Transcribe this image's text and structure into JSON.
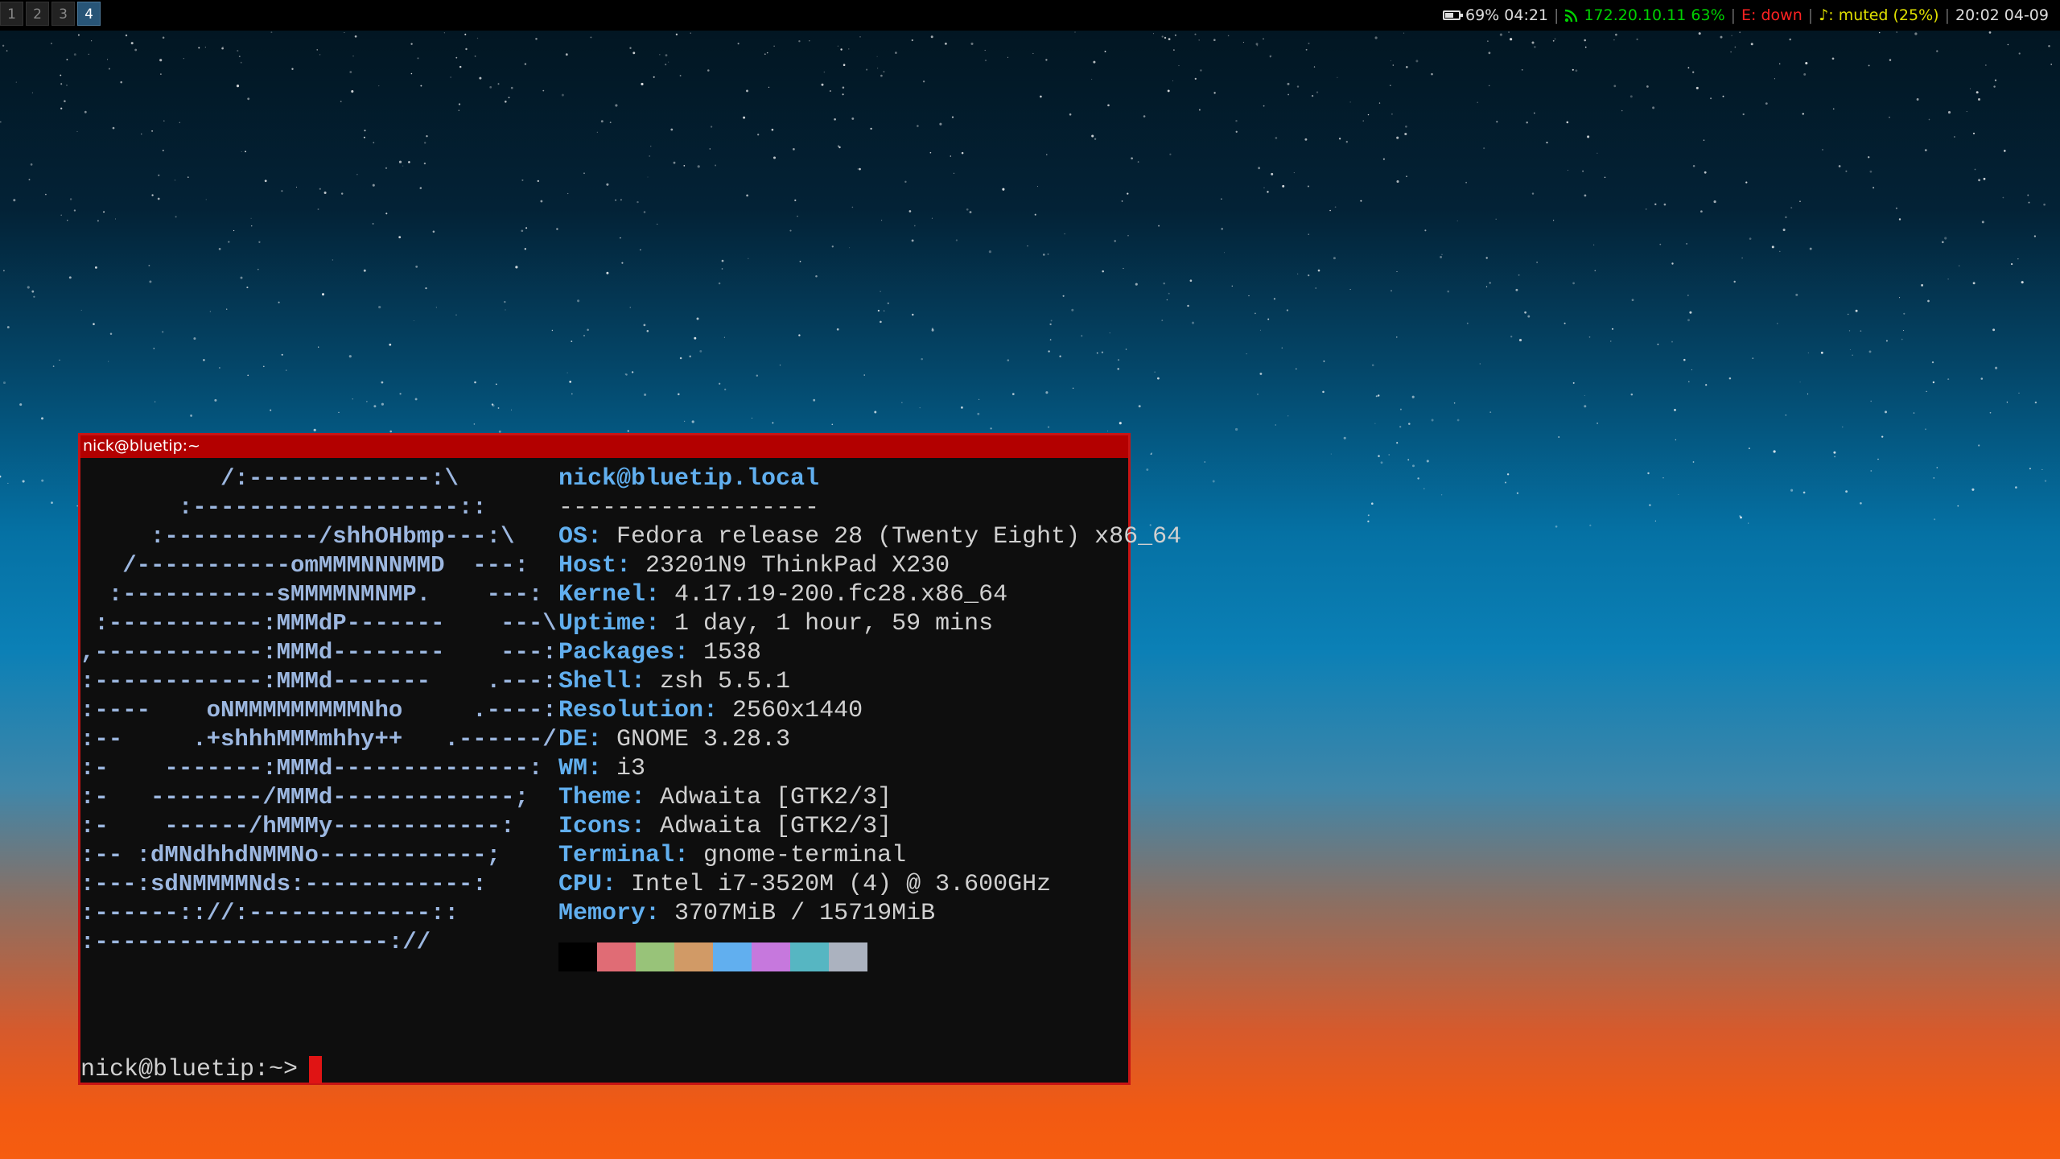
{
  "workspaces": [
    {
      "label": "1",
      "focused": false
    },
    {
      "label": "2",
      "focused": false
    },
    {
      "label": "3",
      "focused": false
    },
    {
      "label": "4",
      "focused": true
    }
  ],
  "statusbar": {
    "battery": {
      "icon": "battery-icon",
      "text": "69% 04:21",
      "level_percent": 69,
      "color": "#dddddd"
    },
    "wifi": {
      "icon": "wifi-icon",
      "text": "172.20.10.11  63%",
      "color": "#00d000"
    },
    "ethernet": {
      "text": "E: down",
      "color": "#ff2222"
    },
    "volume": {
      "text": "♪: muted (25%)",
      "color": "#e0e000"
    },
    "clock": {
      "text": "20:02 04-09",
      "color": "#dddddd"
    },
    "separator": "|"
  },
  "window": {
    "title": "nick@bluetip:~",
    "border_color": "#c81414"
  },
  "neofetch": {
    "logo": [
      "          /:-------------:\\",
      "       :-------------------::",
      "     :-----------/shhOHbmp---:\\",
      "   /-----------omMMMNNNMMD  ---:",
      "  :-----------sMMMMNMNMP.    ---:",
      " :-----------:MMMdP-------    ---\\",
      ",------------:MMMd--------    ---:",
      ":------------:MMMd-------    .---:",
      ":----    oNMMMMMMMMMNho     .----:",
      ":--     .+shhhMMMmhhy++   .------/",
      ":-    -------:MMMd--------------:",
      ":-   --------/MMMd-------------;",
      ":-    ------/hMMMy------------:",
      ":-- :dMNdhhdNMMNo------------;",
      ":---:sdNMMMMNds:------------:",
      ":------:://:-------------::",
      ":---------------------://"
    ],
    "header": "nick@bluetip.local",
    "rule": "------------------",
    "fields": [
      {
        "key": "OS",
        "value": "Fedora release 28 (Twenty Eight) x86_64"
      },
      {
        "key": "Host",
        "value": "23201N9 ThinkPad X230"
      },
      {
        "key": "Kernel",
        "value": "4.17.19-200.fc28.x86_64"
      },
      {
        "key": "Uptime",
        "value": "1 day, 1 hour, 59 mins"
      },
      {
        "key": "Packages",
        "value": "1538"
      },
      {
        "key": "Shell",
        "value": "zsh 5.5.1"
      },
      {
        "key": "Resolution",
        "value": "2560x1440"
      },
      {
        "key": "DE",
        "value": "GNOME 3.28.3"
      },
      {
        "key": "WM",
        "value": "i3"
      },
      {
        "key": "Theme",
        "value": "Adwaita [GTK2/3]"
      },
      {
        "key": "Icons",
        "value": "Adwaita [GTK2/3]"
      },
      {
        "key": "Terminal",
        "value": "gnome-terminal"
      },
      {
        "key": "CPU",
        "value": "Intel i7-3520M (4) @ 3.600GHz"
      },
      {
        "key": "Memory",
        "value": "3707MiB / 15719MiB"
      }
    ],
    "palette": [
      "#000000",
      "#e06c75",
      "#98c379",
      "#d19a66",
      "#61afef",
      "#c678dd",
      "#56b6c2",
      "#abb2bf"
    ]
  },
  "prompt": {
    "text": "nick@bluetip:~>"
  }
}
